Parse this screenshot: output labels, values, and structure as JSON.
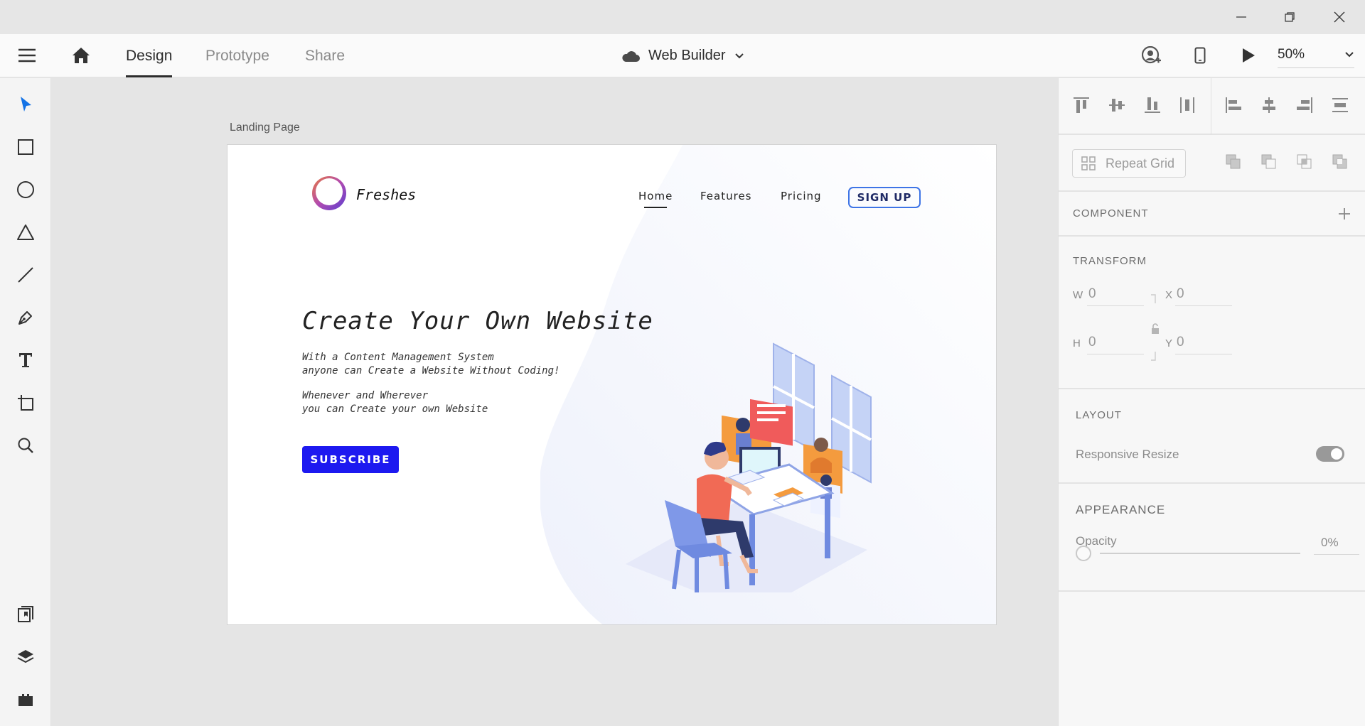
{
  "window": {
    "minimize_icon": "minimize-icon",
    "restore_icon": "restore-icon",
    "close_icon": "close-icon"
  },
  "toolbar": {
    "menu_icon": "hamburger-menu-icon",
    "home_icon": "home-icon",
    "tabs": [
      {
        "label": "Design",
        "active": true
      },
      {
        "label": "Prototype",
        "active": false
      },
      {
        "label": "Share",
        "active": false
      }
    ],
    "cloud_icon": "cloud-icon",
    "document_title": "Web Builder",
    "chevron_icon": "chevron-down-icon",
    "invite_icon": "invite-user-icon",
    "device_preview_icon": "mobile-preview-icon",
    "play_icon": "play-icon",
    "zoom": "50%"
  },
  "tools": [
    {
      "name": "select-tool",
      "icon": "cursor-arrow-icon",
      "active": true
    },
    {
      "name": "rectangle-tool",
      "icon": "rectangle-icon"
    },
    {
      "name": "ellipse-tool",
      "icon": "ellipse-icon"
    },
    {
      "name": "polygon-tool",
      "icon": "triangle-icon"
    },
    {
      "name": "line-tool",
      "icon": "line-icon"
    },
    {
      "name": "pen-tool",
      "icon": "pen-icon"
    },
    {
      "name": "text-tool",
      "icon": "text-icon"
    },
    {
      "name": "artboard-tool",
      "icon": "artboard-icon"
    },
    {
      "name": "zoom-tool",
      "icon": "magnifier-icon"
    },
    {
      "name": "assets-panel",
      "icon": "assets-icon"
    },
    {
      "name": "layers-panel",
      "icon": "layers-icon"
    },
    {
      "name": "plugins-panel",
      "icon": "plugins-icon"
    }
  ],
  "canvas": {
    "artboard_label": "Landing Page",
    "site": {
      "brand": "Freshes",
      "nav": [
        "Home",
        "Features",
        "Pricing"
      ],
      "signup": "SIGN UP",
      "headline": "Create Your Own Website",
      "paragraph1_line1": "With a Content Management System",
      "paragraph1_line2": "anyone can Create a Website Without Coding!",
      "paragraph2_line1": "Whenever and Wherever",
      "paragraph2_line2": "you can Create your own Website",
      "cta": "SUBSCRIBE",
      "accent_color": "#1d19f0"
    }
  },
  "panel": {
    "repeat_grid": "Repeat Grid",
    "component_title": "COMPONENT",
    "transform_title": "TRANSFORM",
    "transform": {
      "w_label": "W",
      "w_value": "0",
      "h_label": "H",
      "h_value": "0",
      "x_label": "X",
      "x_value": "0",
      "y_label": "Y",
      "y_value": "0"
    },
    "layout_title": "LAYOUT",
    "responsive_resize": "Responsive Resize",
    "appearance_title": "APPEARANCE",
    "opacity_label": "Opacity",
    "opacity_value": "0%"
  }
}
